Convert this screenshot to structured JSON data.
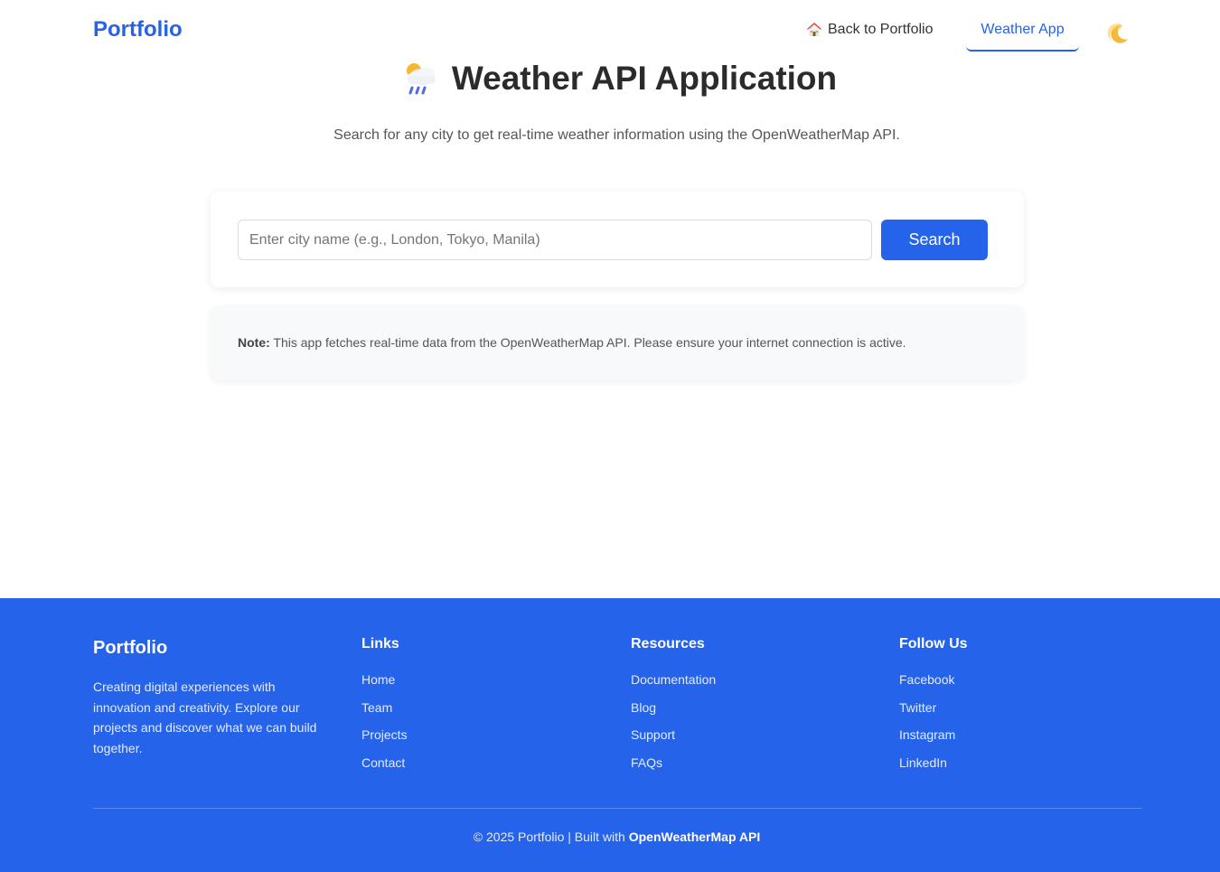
{
  "header": {
    "brand": "Portfolio",
    "nav_back_label": "Back to Portfolio",
    "nav_back_icon": "house-icon",
    "nav_active_label": "Weather App",
    "theme_toggle_icon": "moon-icon"
  },
  "hero": {
    "icon": "cloud-rain-icon",
    "title": "Weather API Application",
    "subtitle": "Search for any city to get real-time weather information using the OpenWeatherMap API."
  },
  "search": {
    "placeholder": "Enter city name (e.g., London, Tokyo, Manila)",
    "value": "",
    "button_label": "Search"
  },
  "note": {
    "label": "Note:",
    "text": "This app fetches real-time data from the OpenWeatherMap API. Please ensure your internet connection is active."
  },
  "footer": {
    "brand": "Portfolio",
    "description": "Creating digital experiences with innovation and creativity. Explore our projects and discover what we can build together.",
    "columns": [
      {
        "heading": "Links",
        "items": [
          "Home",
          "Team",
          "Projects",
          "Contact"
        ]
      },
      {
        "heading": "Resources",
        "items": [
          "Documentation",
          "Blog",
          "Support",
          "FAQs"
        ]
      },
      {
        "heading": "Follow Us",
        "items": [
          "Facebook",
          "Twitter",
          "Instagram",
          "LinkedIn"
        ]
      }
    ],
    "copyright_prefix": "© 2025 Portfolio | Built with",
    "copyright_strong": "OpenWeatherMap API"
  },
  "colors": {
    "accent": "#2563eb",
    "footer_bg": "#2563eb",
    "text_dark": "#2b2b2b",
    "note_bg": "#f8f9fb"
  }
}
